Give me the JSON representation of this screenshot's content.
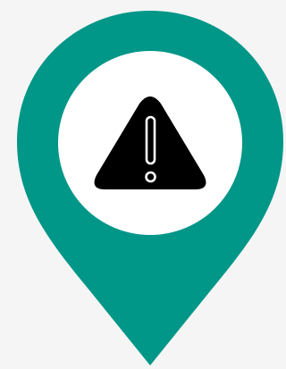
{
  "background_color": "#f5f5f5",
  "pin": {
    "icon": "map-pin-icon",
    "color": "#009688"
  },
  "badge": {
    "color": "#ffffff"
  },
  "warning": {
    "icon": "warning-triangle-icon",
    "color": "#000000",
    "mark_color": "#ffffff"
  }
}
